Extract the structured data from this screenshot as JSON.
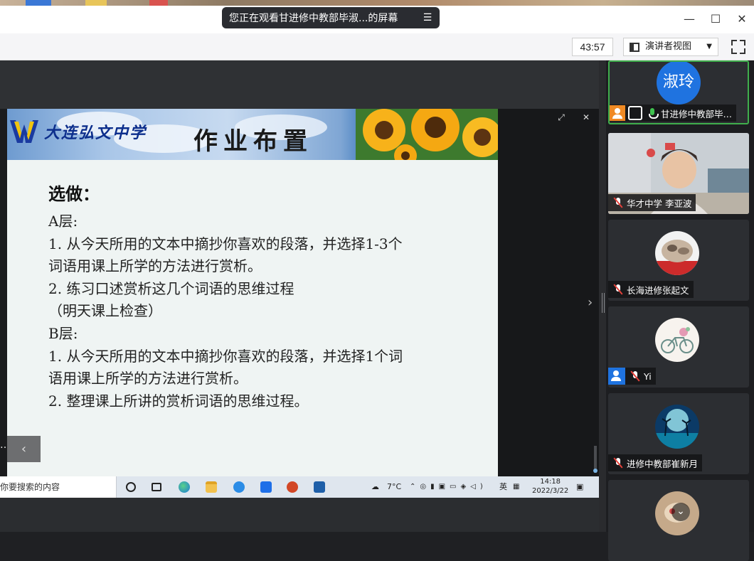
{
  "window": {
    "share_banner": "您正在观看甘进修中教部毕淑...的屏幕",
    "minimize": "—",
    "maximize": "☐",
    "close": "✕"
  },
  "toolbar": {
    "timer": "43:57",
    "view_mode": "演讲者视图",
    "view_caret": "▼"
  },
  "slide": {
    "logo_text": "大连弘文中学",
    "title": "作业布置",
    "heading": "选做：",
    "lines": [
      "A层:",
      "1. 从今天所用的文本中摘抄你喜欢的段落，并选择1-3个",
      "词语用课上所学的方法进行赏析。",
      "2. 练习口述赏析这几个词语的思维过程",
      "（明天课上检查）",
      "B层:",
      "1. 从今天所用的文本中摘抄你喜欢的段落，并选择1个词",
      "语用课上所学的方法进行赏析。",
      "2. 整理课上所讲的赏析词语的思维过程。"
    ]
  },
  "shared_screen": {
    "ellipsis": "…",
    "prev_arrow": "‹",
    "side_arrow": "›",
    "popout": "⤢",
    "close_x": "✕",
    "taskbar_search": "你要搜索的内容",
    "weather": "7°C",
    "lang": "英",
    "time": "14:18",
    "date": "2022/3/22"
  },
  "participants": [
    {
      "name": "甘进修中教部毕…",
      "avatar_text": "淑玲",
      "muted": false,
      "host": true
    },
    {
      "name": "华才中学 李亚波",
      "muted": true
    },
    {
      "name": "长海进修张起文",
      "muted": true
    },
    {
      "name": "Yi",
      "muted": true
    },
    {
      "name": "进修中教部崔新月",
      "muted": true
    }
  ],
  "panel": {
    "scroll_down": "⌄"
  },
  "colors": {
    "accent_blue": "#1f73e0",
    "active_green": "#3fae4c",
    "host_orange": "#f08a24",
    "muted_red": "#e5413a"
  }
}
